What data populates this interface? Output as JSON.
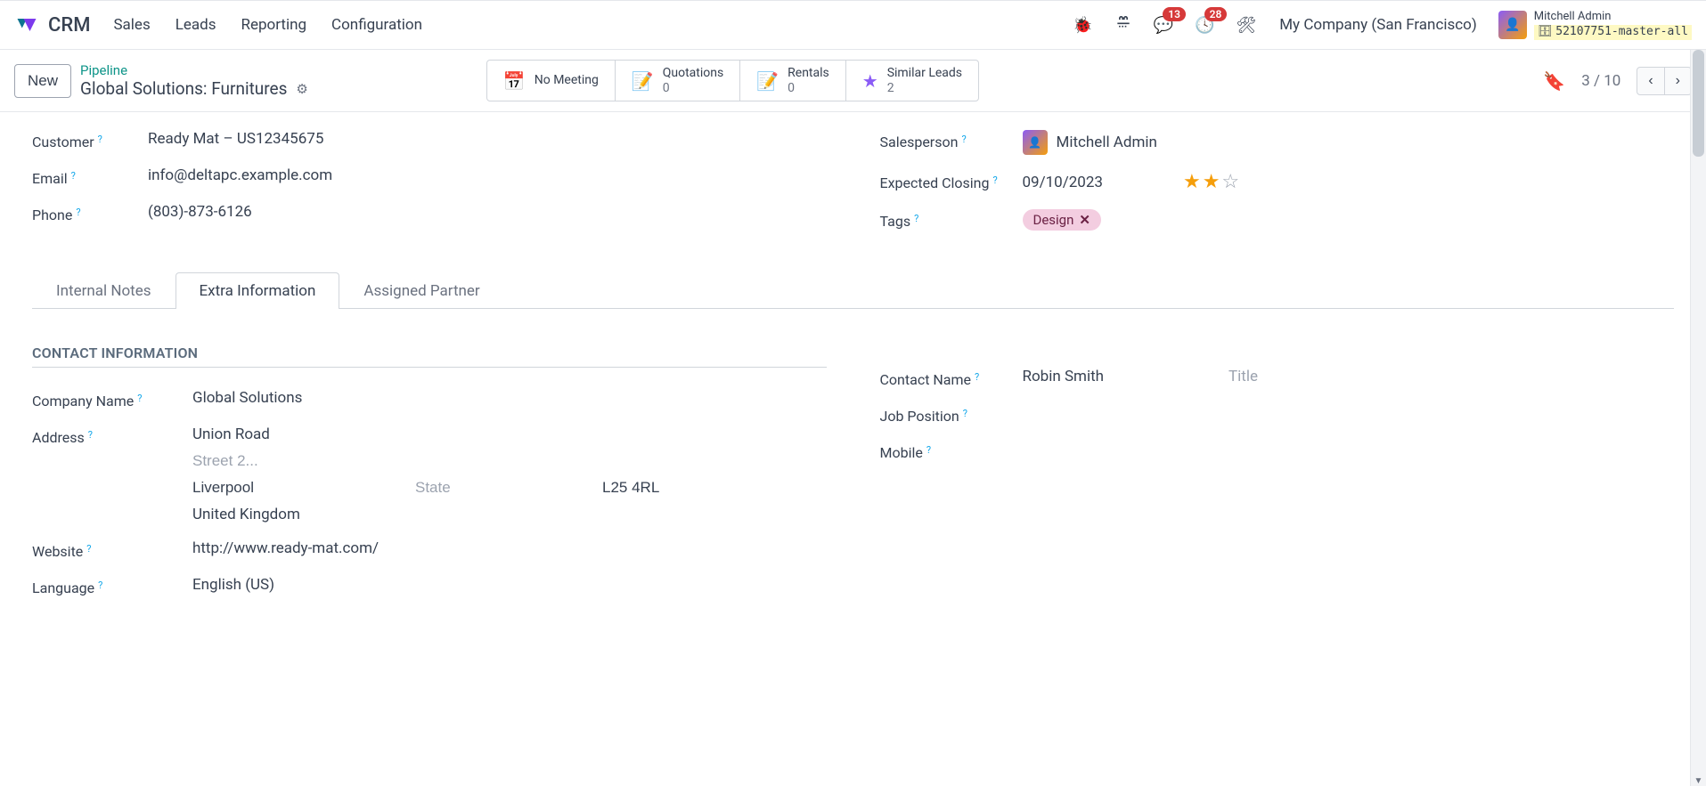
{
  "nav": {
    "brand": "CRM",
    "items": [
      "Sales",
      "Leads",
      "Reporting",
      "Configuration"
    ],
    "badges": {
      "messages": "13",
      "activities": "28"
    },
    "company": "My Company (San Francisco)",
    "user_name": "Mitchell Admin",
    "db_label": "52107751-master-all"
  },
  "control": {
    "new_label": "New",
    "breadcrumb_link": "Pipeline",
    "breadcrumb_title": "Global Solutions: Furnitures",
    "stats": {
      "meeting_label": "No Meeting",
      "quotations_label": "Quotations",
      "quotations_count": "0",
      "rentals_label": "Rentals",
      "rentals_count": "0",
      "similar_label": "Similar Leads",
      "similar_count": "2"
    },
    "pager": "3 / 10"
  },
  "fields": {
    "customer_label": "Customer",
    "customer_value": "Ready Mat – US12345675",
    "email_label": "Email",
    "email_value": "info@deltapc.example.com",
    "phone_label": "Phone",
    "phone_value": "(803)-873-6126",
    "salesperson_label": "Salesperson",
    "salesperson_value": "Mitchell Admin",
    "closing_label": "Expected Closing",
    "closing_value": "09/10/2023",
    "tags_label": "Tags",
    "tag_value": "Design"
  },
  "tabs": {
    "t1": "Internal Notes",
    "t2": "Extra Information",
    "t3": "Assigned Partner"
  },
  "contact": {
    "section": "CONTACT INFORMATION",
    "company_label": "Company Name",
    "company_value": "Global Solutions",
    "address_label": "Address",
    "street1": "Union Road",
    "street2_ph": "Street 2...",
    "city": "Liverpool",
    "state_ph": "State",
    "zip": "L25 4RL",
    "country": "United Kingdom",
    "website_label": "Website",
    "website_value": "http://www.ready-mat.com/",
    "language_label": "Language",
    "language_value": "English (US)",
    "contact_name_label": "Contact Name",
    "contact_name_value": "Robin Smith",
    "title_ph": "Title",
    "job_label": "Job Position",
    "mobile_label": "Mobile"
  }
}
